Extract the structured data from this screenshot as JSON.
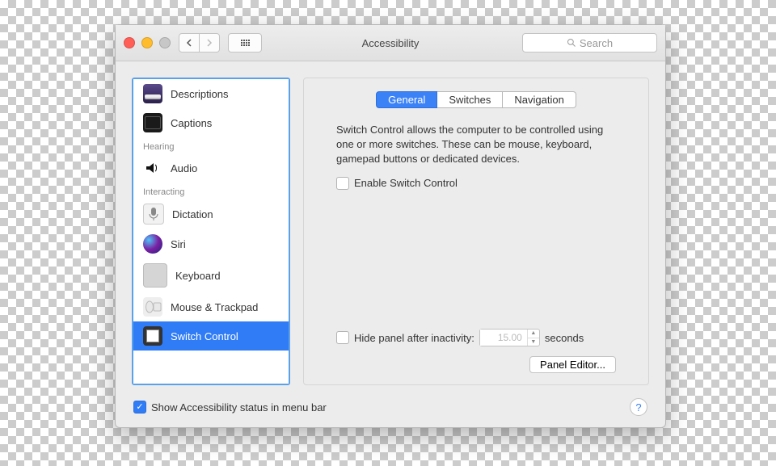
{
  "window": {
    "title": "Accessibility"
  },
  "search": {
    "placeholder": "Search"
  },
  "sidebar": {
    "sections": {
      "hearing": "Hearing",
      "interacting": "Interacting"
    },
    "items": {
      "descriptions": "Descriptions",
      "captions": "Captions",
      "audio": "Audio",
      "dictation": "Dictation",
      "siri": "Siri",
      "keyboard": "Keyboard",
      "mouse": "Mouse & Trackpad",
      "switch": "Switch Control"
    }
  },
  "tabs": {
    "general": "General",
    "switches": "Switches",
    "navigation": "Navigation"
  },
  "panel": {
    "description": "Switch Control allows the computer to be controlled using one or more switches. These can be mouse, keyboard, gamepad buttons or dedicated devices.",
    "enable_label": "Enable Switch Control",
    "hide_label": "Hide panel after inactivity:",
    "hide_value": "15.00",
    "hide_unit": "seconds",
    "panel_editor": "Panel Editor..."
  },
  "footer": {
    "status_label": "Show Accessibility status in menu bar"
  }
}
